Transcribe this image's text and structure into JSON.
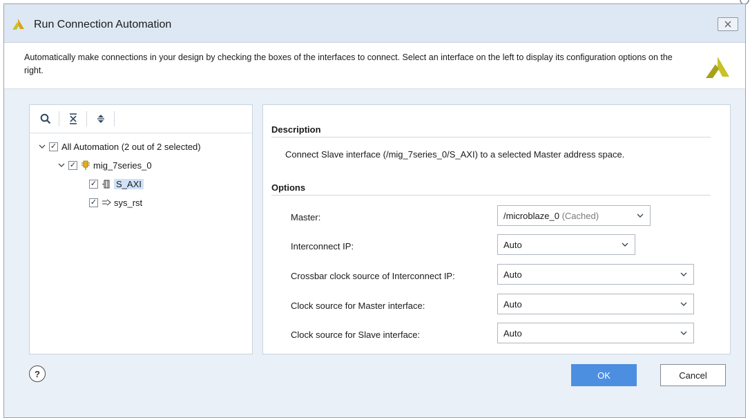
{
  "dialog": {
    "title": "Run Connection Automation",
    "close_label": "⌧",
    "header_text": "Automatically make connections in your design by checking the boxes of the interfaces to connect. Select an interface on the left to display its configuration options on the right."
  },
  "toolbar": {
    "search_icon": "search-icon",
    "collapse_icon": "collapse-all-icon",
    "expand_icon": "expand-all-icon"
  },
  "tree": {
    "root": {
      "label": "All Automation (2 out of 2 selected)",
      "checked": true,
      "expanded": true
    },
    "node": {
      "label": "mig_7series_0",
      "checked": true,
      "expanded": true
    },
    "children": [
      {
        "label": "S_AXI",
        "checked": true,
        "selected": true,
        "icon": "bus-interface-icon"
      },
      {
        "label": "sys_rst",
        "checked": true,
        "selected": false,
        "icon": "reset-port-icon"
      }
    ]
  },
  "details": {
    "description_title": "Description",
    "description_text": "Connect Slave interface (/mig_7series_0/S_AXI) to a selected Master address space.",
    "options_title": "Options",
    "options": [
      {
        "label": "Master:",
        "value": "/microblaze_0",
        "suffix": "(Cached)"
      },
      {
        "label": "Interconnect IP:",
        "value": "Auto",
        "suffix": ""
      },
      {
        "label": "Crossbar clock source of Interconnect IP:",
        "value": "Auto",
        "suffix": ""
      },
      {
        "label": "Clock source for Master interface:",
        "value": "Auto",
        "suffix": ""
      },
      {
        "label": "Clock source for Slave interface:",
        "value": "Auto",
        "suffix": ""
      }
    ]
  },
  "footer": {
    "help_label": "?",
    "ok_label": "OK",
    "cancel_label": "Cancel"
  },
  "colors": {
    "titlebar": "#dde8f4",
    "body_bg": "#eaf0f7",
    "ok_button": "#4c8fe0",
    "selection": "#cfe2f7",
    "logo": "#c8c227"
  }
}
